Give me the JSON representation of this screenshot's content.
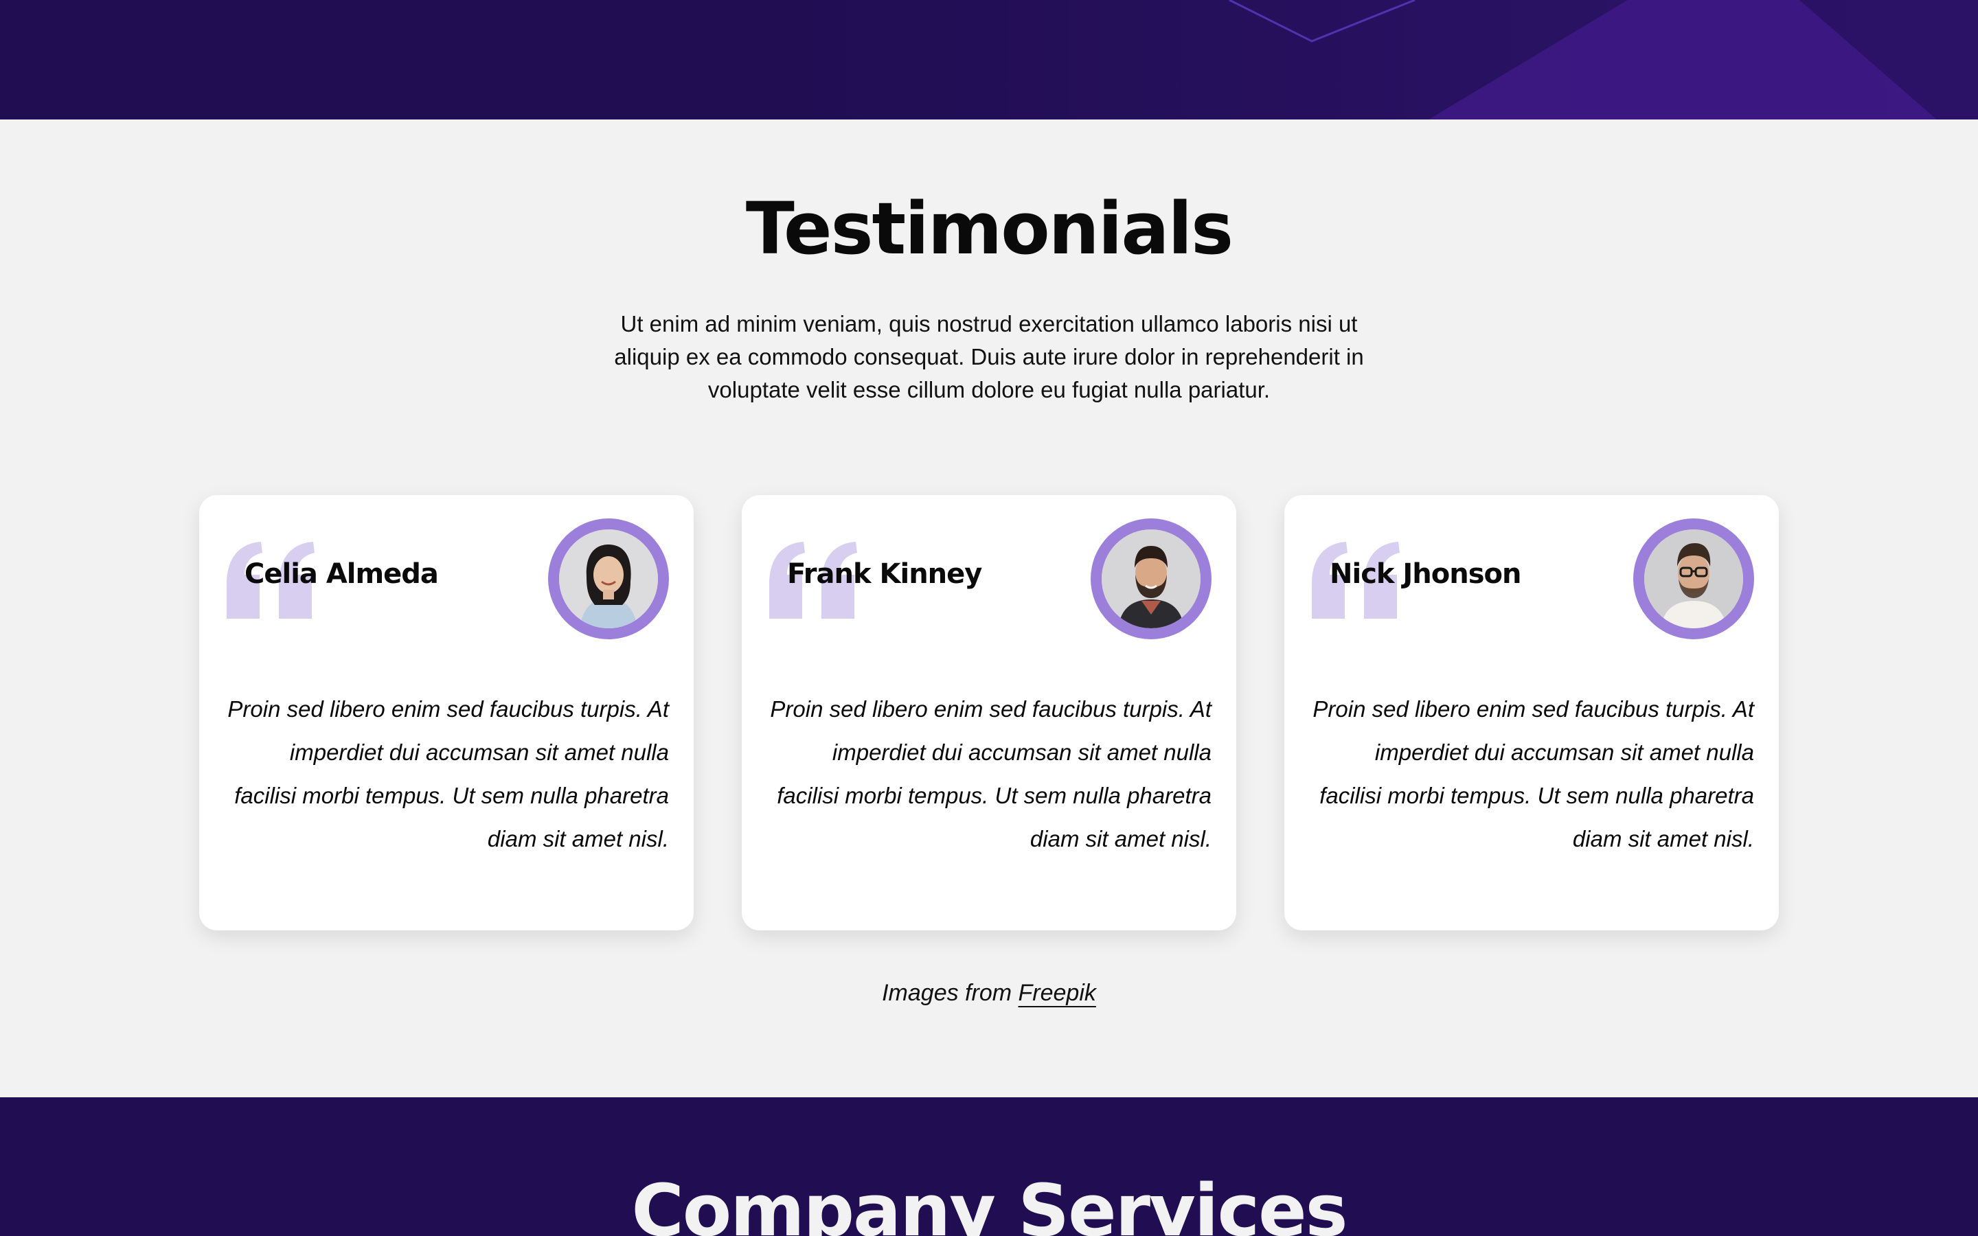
{
  "colors": {
    "dark_purple": "#200d52",
    "accent_purple": "#9b7fda",
    "quote_purple": "#d8cff0",
    "section_bg": "#f2f2f2"
  },
  "testimonials": {
    "title": "Testimonials",
    "intro": "Ut enim ad minim veniam, quis nostrud exercitation ullamco laboris nisi ut aliquip ex ea commodo consequat. Duis aute irure dolor in reprehenderit in voluptate velit esse cillum dolore eu fugiat nulla pariatur.",
    "cards": [
      {
        "name": "Celia Almeda",
        "icon": "quote-icon",
        "avatar": "avatar-woman",
        "text": "Proin sed libero enim sed faucibus turpis. At imperdiet dui accumsan sit amet nulla facilisi morbi tempus. Ut sem nulla pharetra diam sit amet nisl."
      },
      {
        "name": "Frank Kinney",
        "icon": "quote-icon",
        "avatar": "avatar-bearded-man",
        "text": "Proin sed libero enim sed faucibus turpis. At imperdiet dui accumsan sit amet nulla facilisi morbi tempus. Ut sem nulla pharetra diam sit amet nisl."
      },
      {
        "name": "Nick Jhonson",
        "icon": "quote-icon",
        "avatar": "avatar-man-glasses",
        "text": "Proin sed libero enim sed faucibus turpis. At imperdiet dui accumsan sit amet nulla facilisi morbi tempus. Ut sem nulla pharetra diam sit amet nisl."
      }
    ],
    "credit_prefix": "Images from ",
    "credit_link": "Freepik"
  },
  "services": {
    "title": "Company Services"
  }
}
